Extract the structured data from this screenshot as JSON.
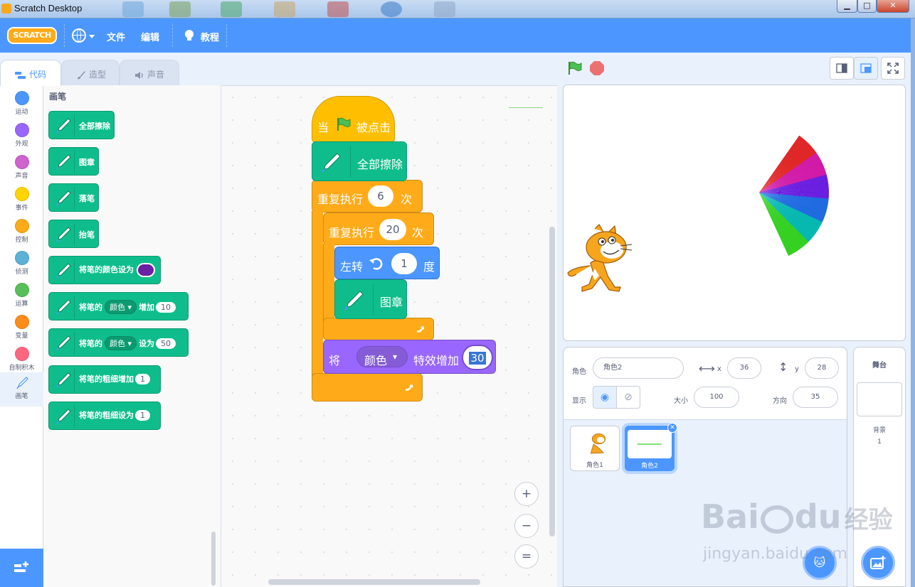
{
  "window": {
    "title": "Scratch Desktop",
    "minimize": "▁",
    "maximize": "□",
    "close": "✕"
  },
  "menubar": {
    "logo": "SCRATCH",
    "file": "文件",
    "edit": "编辑",
    "tutorials": "教程"
  },
  "tabs": [
    {
      "label": "代码"
    },
    {
      "label": "造型"
    },
    {
      "label": "声音"
    }
  ],
  "categories": [
    {
      "label": "运动",
      "color": "#4c97ff"
    },
    {
      "label": "外观",
      "color": "#9966ff"
    },
    {
      "label": "声音",
      "color": "#cf63cf"
    },
    {
      "label": "事件",
      "color": "#ffd500"
    },
    {
      "label": "控制",
      "color": "#ffab19"
    },
    {
      "label": "侦测",
      "color": "#5cb1d6"
    },
    {
      "label": "运算",
      "color": "#59c059"
    },
    {
      "label": "变量",
      "color": "#ff8c1a"
    },
    {
      "label": "自制积木",
      "color": "#ff6680"
    },
    {
      "label": "画笔",
      "color": "#0fbd8c"
    }
  ],
  "palette": {
    "heading": "画笔",
    "blocks": [
      {
        "text": "全部擦除"
      },
      {
        "text": "图章"
      },
      {
        "text": "落笔"
      },
      {
        "text": "抬笔"
      },
      {
        "text": "将笔的颜色设为"
      },
      {
        "pre": "将笔的",
        "dropdown": "颜色",
        "post": "增加",
        "value": "10"
      },
      {
        "pre": "将笔的",
        "dropdown": "颜色",
        "post": "设为",
        "value": "50"
      },
      {
        "text": "将笔的粗细增加",
        "value": "1"
      },
      {
        "text": "将笔的粗细设为",
        "value": "1"
      }
    ]
  },
  "script": {
    "hat_when": "当",
    "hat_clicked": "被点击",
    "clear": "全部擦除",
    "repeat_outer_label": "重复执行",
    "repeat_outer_count": "6",
    "repeat_outer_unit": "次",
    "repeat_inner_label": "重复执行",
    "repeat_inner_count": "20",
    "repeat_inner_unit": "次",
    "turn_label": "左转",
    "turn_value": "1",
    "turn_unit": "度",
    "stamp": "图章",
    "effect_pre": "将",
    "effect_dropdown": "颜色",
    "effect_post": "特效增加",
    "effect_value": "30"
  },
  "zoom": {
    "in": "+",
    "out": "−",
    "reset": "="
  },
  "sprite_info": {
    "sprite_label": "角色",
    "sprite_name": "角色2",
    "x_label": "x",
    "x_value": "36",
    "y_label": "y",
    "y_value": "28",
    "show_label": "显示",
    "size_label": "大小",
    "size_value": "100",
    "direction_label": "方向",
    "direction_value": "35"
  },
  "sprites": [
    {
      "name": "角色1"
    },
    {
      "name": "角色2"
    }
  ],
  "stage_pane": {
    "title": "舞台",
    "backdrops_label": "背景",
    "backdrops_count": "1"
  },
  "watermark": {
    "brand": "Bai",
    "brand2": "du",
    "jingyan": "经验",
    "url": "jingyan.baidu.com"
  },
  "fan_colors": [
    "#e02626",
    "#d11aa8",
    "#6a1fe0",
    "#1f6be0",
    "#06b8b0",
    "#34d020"
  ]
}
